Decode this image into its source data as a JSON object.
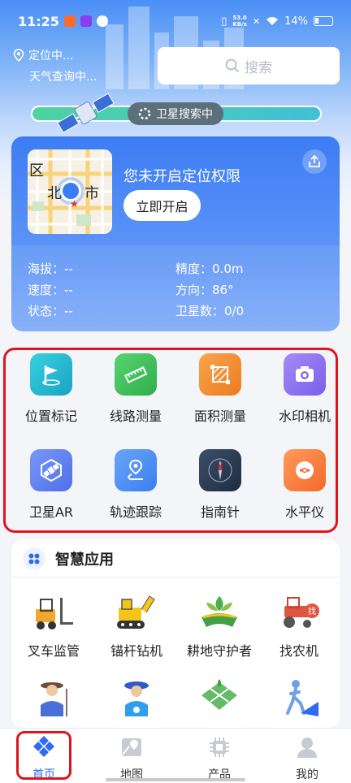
{
  "status_bar": {
    "time": "11:25",
    "speed_value": "53.0",
    "speed_unit": "KB/s",
    "battery": "14%"
  },
  "location": {
    "line1": "定位中...",
    "line2": "天气查询中..."
  },
  "search": {
    "placeholder": "搜索"
  },
  "satellite_search": {
    "label": "卫星搜索中"
  },
  "card": {
    "title": "您未开启定位权限",
    "open_button": "立即开启",
    "map_labels": [
      "区",
      "北",
      "市"
    ],
    "stats": {
      "altitude_label": "海拔：",
      "altitude_value": "--",
      "accuracy_label": "精度：",
      "accuracy_value": "0.0m",
      "speed_label": "速度：",
      "speed_value": "--",
      "direction_label": "方向：",
      "direction_value": "86°",
      "state_label": "状态：",
      "state_value": "--",
      "satellites_label": "卫星数：",
      "satellites_value": "0/0"
    }
  },
  "tools": [
    {
      "label": "位置标记",
      "icon": "flag-icon",
      "color": "#23b7cf"
    },
    {
      "label": "线路测量",
      "icon": "ruler-icon",
      "color": "#3fbf5e"
    },
    {
      "label": "面积测量",
      "icon": "area-icon",
      "color": "#f28a2e"
    },
    {
      "label": "水印相机",
      "icon": "camera-icon",
      "color": "#8a6cf0"
    },
    {
      "label": "卫星AR",
      "icon": "satellite-ar-icon",
      "color": "#5a7df2"
    },
    {
      "label": "轨迹跟踪",
      "icon": "route-icon",
      "color": "#4e8ff5"
    },
    {
      "label": "指南针",
      "icon": "compass-icon",
      "color": "#2f3e55"
    },
    {
      "label": "水平仪",
      "icon": "level-icon",
      "color": "#f57a3c"
    }
  ],
  "smart_apps": {
    "title": "智慧应用",
    "items": [
      {
        "label": "叉车监管",
        "icon": "forklift-icon"
      },
      {
        "label": "锚杆钻机",
        "icon": "drill-rig-icon"
      },
      {
        "label": "耕地守护者",
        "icon": "farmland-icon"
      },
      {
        "label": "找农机",
        "icon": "tractor-icon"
      },
      {
        "label": "",
        "icon": "farmer-icon"
      },
      {
        "label": "",
        "icon": "worker-icon"
      },
      {
        "label": "",
        "icon": "field-grid-icon"
      },
      {
        "label": "",
        "icon": "walker-icon"
      }
    ]
  },
  "nav": [
    {
      "label": "首页",
      "icon": "home-diamond-icon",
      "active": true
    },
    {
      "label": "地图",
      "icon": "map-icon",
      "active": false
    },
    {
      "label": "产品",
      "icon": "chip-icon",
      "active": false
    },
    {
      "label": "我的",
      "icon": "user-icon",
      "active": false
    }
  ],
  "colors": {
    "accent": "#2f6bf2",
    "highlight_border": "#e0141c",
    "card_blue": "#3d7cf4"
  }
}
